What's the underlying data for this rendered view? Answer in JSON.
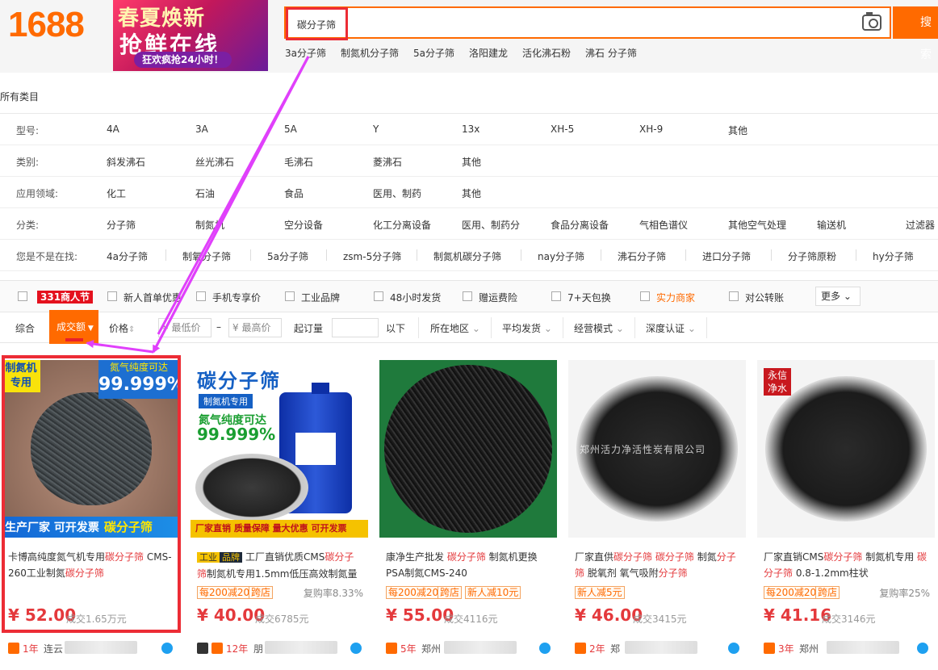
{
  "header": {
    "logo": "1688",
    "banner_line1": "春夏焕新",
    "banner_line2": "抢鲜在线",
    "banner_line3": "狂欢疯抢24小时！",
    "search_value": "碳分子筛",
    "search_button": "搜索",
    "hot_words": [
      "3a分子筛",
      "制氮机分子筛",
      "5a分子筛",
      "洛阳建龙",
      "活化沸石粉",
      "沸石 分子筛"
    ]
  },
  "breadcrumb": "所有类目",
  "filters": {
    "model": {
      "label": "型号:",
      "options": [
        "4A",
        "3A",
        "5A",
        "Y",
        "13x",
        "XH-5",
        "XH-9",
        "其他"
      ]
    },
    "category": {
      "label": "类别:",
      "options": [
        "斜发沸石",
        "丝光沸石",
        "毛沸石",
        "菱沸石",
        "其他"
      ]
    },
    "application": {
      "label": "应用领域:",
      "options": [
        "化工",
        "石油",
        "食品",
        "医用、制药",
        "其他"
      ]
    },
    "classification": {
      "label": "分类:",
      "options": [
        "分子筛",
        "制氮机",
        "空分设备",
        "化工分离设备",
        "医用、制药分",
        "食品分离设备",
        "气相色谱仪",
        "其他空气处理",
        "输送机",
        "过滤器"
      ]
    },
    "suggest": {
      "label": "您是不是在找:",
      "options": [
        "4a分子筛",
        "制氧分子筛",
        "5a分子筛",
        "zsm-5分子筛",
        "制氮机碳分子筛",
        "nay分子筛",
        "沸石分子筛",
        "进口分子筛",
        "分子筛原粉",
        "hy分子筛"
      ]
    }
  },
  "service_bar": {
    "badge": "331商人节",
    "items": [
      "新人首单优惠",
      "手机专享价",
      "工业品牌",
      "48小时发货",
      "赠运费险",
      "7+天包换",
      "实力商家",
      "对公转账"
    ],
    "more": "更多"
  },
  "sort_bar": {
    "overall": "综合",
    "sales": "成交额",
    "price": "价格",
    "min_price": "¥ 最低价",
    "dash": "–",
    "max_price": "¥ 最高价",
    "min_order": "起订量",
    "below": "以下",
    "region": "所在地区",
    "avg_ship": "平均发货",
    "biz_mode": "经营模式",
    "depth_cert": "深度认证"
  },
  "products": [
    {
      "img": {
        "tl_tag": "制氮机\n专用",
        "tr_a": "氮气纯度可达",
        "tr_b": "99.999%",
        "strip": "生产厂家 可开发票",
        "strip_hl": "碳分子筛"
      },
      "title_a": "卡博高纯度氮气机专用",
      "title_red1": "碳分子筛",
      "title_b": " CMS-260工业制氮",
      "title_red2": "碳分子筛",
      "title_c": "",
      "price": "¥ 52.00",
      "sold": "成交1.65万元",
      "year": "1年",
      "shop": "连云"
    },
    {
      "img": {
        "ttl": "碳分子筛",
        "sub": "制氮机专用",
        "p1": "氮气纯度可达",
        "p2": "99.999%",
        "strip": "厂家直销 质量保障 量大优惠 可开发票"
      },
      "brand_a": "工业",
      "brand_b": "品牌",
      "title_a": "工厂直销优质CMS",
      "title_red1": "碳分子筛",
      "title_b": "制氮机专用1.5mm低压高效制氮量",
      "tag1": "每200减20",
      "tag2": "跨店",
      "repeat": "复购率8.33%",
      "price": "¥ 40.00",
      "sold": "成交6785元",
      "year": "12年",
      "shop": "朋"
    },
    {
      "title_a": "康净生产批发 ",
      "title_red1": "碳分子筛",
      "title_b": " 制氮机更换PSA制氮CMS-240",
      "tag1": "每200减20",
      "tag2": "跨店",
      "tag3": "新人减10元",
      "price": "¥ 55.00",
      "sold": "成交4116元",
      "year": "5年",
      "shop": "郑州"
    },
    {
      "img": {
        "wm": "郑州活力净活性炭有限公司"
      },
      "title_a": "厂家直供",
      "title_red1": "碳分子筛",
      "title_mid": " ",
      "title_red2": "碳分子筛",
      "title_b": " 制氮",
      "title_red3": "分子筛",
      "title_c": " 脱氧剂 氧气吸附",
      "title_red4": "分子筛",
      "tag1": "新人减5元",
      "price": "¥ 46.00",
      "sold": "成交3415元",
      "year": "2年",
      "shop": "郑"
    },
    {
      "img": {
        "stamp": "永信\n净水"
      },
      "title_a": "厂家直销CMS",
      "title_red1": "碳分子筛",
      "title_b": " 制氮机专用 ",
      "title_red2": "碳分子筛",
      "title_c": " 0.8-1.2mm柱状",
      "tag1": "每200减20",
      "tag2": "跨店",
      "repeat": "复购率25%",
      "price": "¥ 41.16",
      "sold": "成交3146元",
      "year": "3年",
      "shop": "郑州"
    }
  ],
  "colors": {
    "brand": "#ff6a00",
    "highlight": "#ec2c35",
    "arrow": "#e040fb",
    "price": "#e4393c"
  }
}
